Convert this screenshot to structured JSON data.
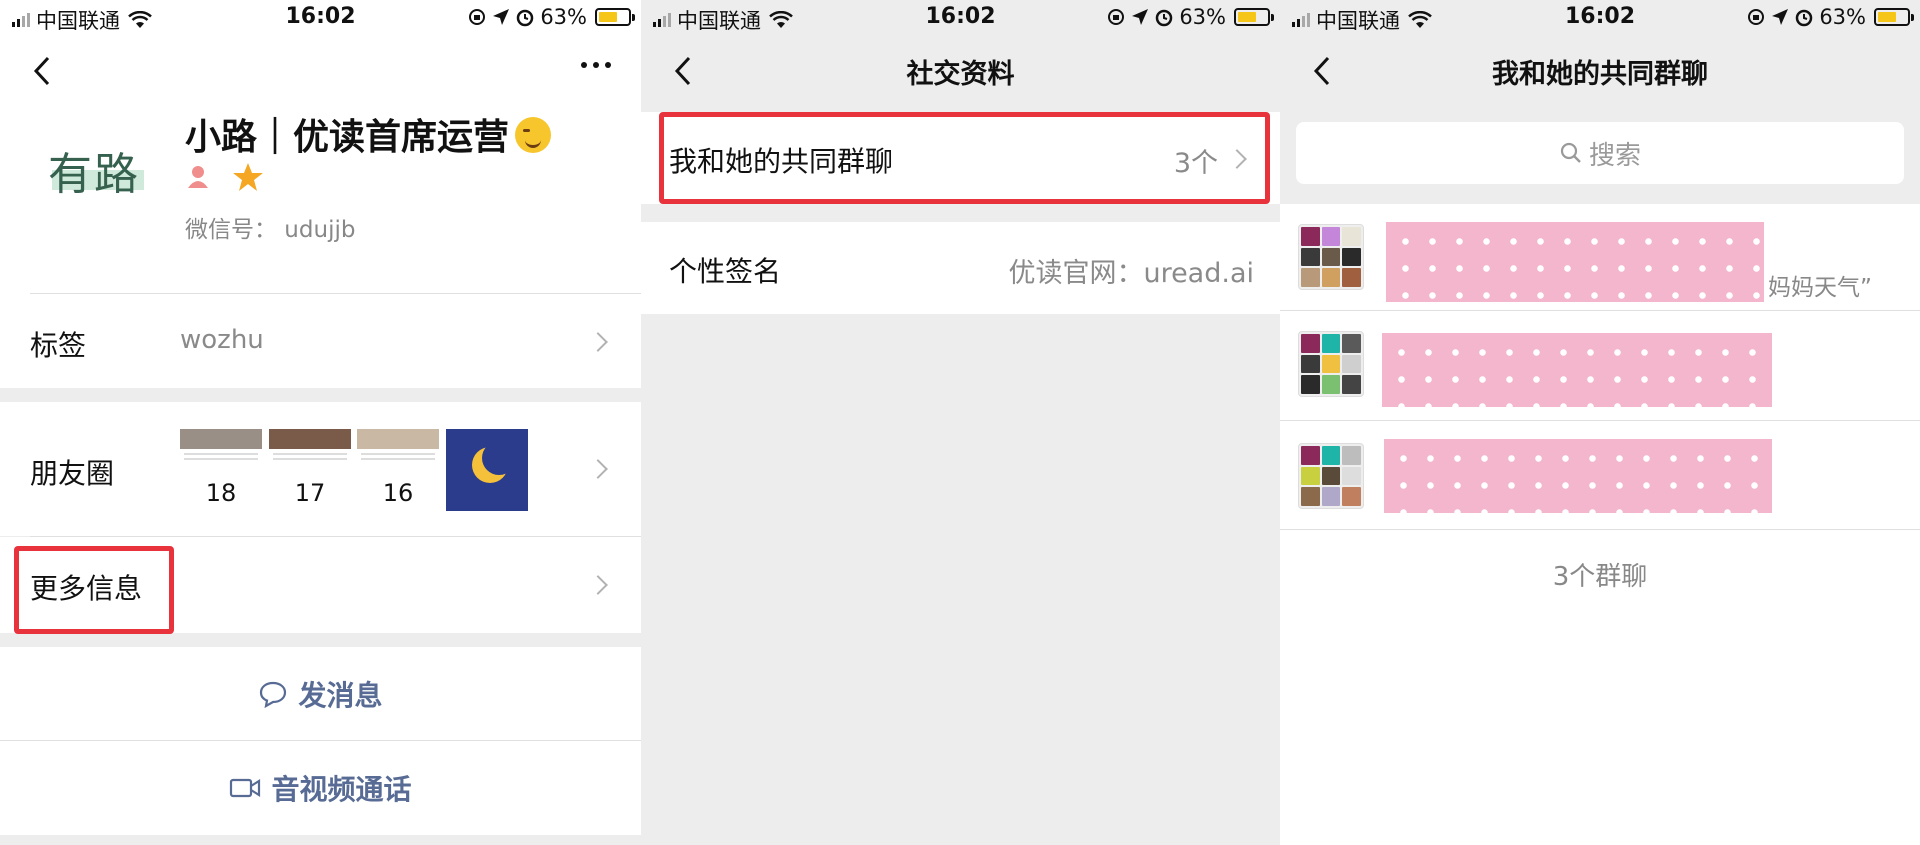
{
  "status_bar": {
    "carrier": "中国联通",
    "time": "16:02",
    "battery": "63%",
    "battery_level": 0.63
  },
  "panel1": {
    "profile": {
      "logo_text": "有路",
      "name": "小路｜优读首席运营",
      "wechat_id": "微信号： udujjb"
    },
    "tags": {
      "label": "标签",
      "value": "wozhu"
    },
    "moments": {
      "label": "朋友圈",
      "thumbs": [
        {
          "number": "18",
          "color": "#9a8f86"
        },
        {
          "number": "17",
          "color": "#7a5a48"
        },
        {
          "number": "16",
          "color": "#c9b9a4"
        }
      ]
    },
    "more_info": {
      "label": "更多信息"
    },
    "actions": {
      "message": "发消息",
      "call": "音视频通话"
    }
  },
  "panel2": {
    "title": "社交资料",
    "common_groups": {
      "label": "我和她的共同群聊",
      "value": "3个"
    },
    "signature": {
      "label": "个性签名",
      "value": "优读官网：uread.ai"
    }
  },
  "panel3": {
    "title": "我和她的共同群聊",
    "search_placeholder": "搜索",
    "groups": [
      {
        "name_visible": "妈妈天气”"
      },
      {
        "name_visible": ""
      },
      {
        "name_visible": ""
      }
    ],
    "count": "3个群聊"
  },
  "colors": {
    "accent_link": "#576b95",
    "highlight_border": "#e8323c",
    "mask_pink": "#f4b6cc",
    "star": "#f5a623"
  }
}
